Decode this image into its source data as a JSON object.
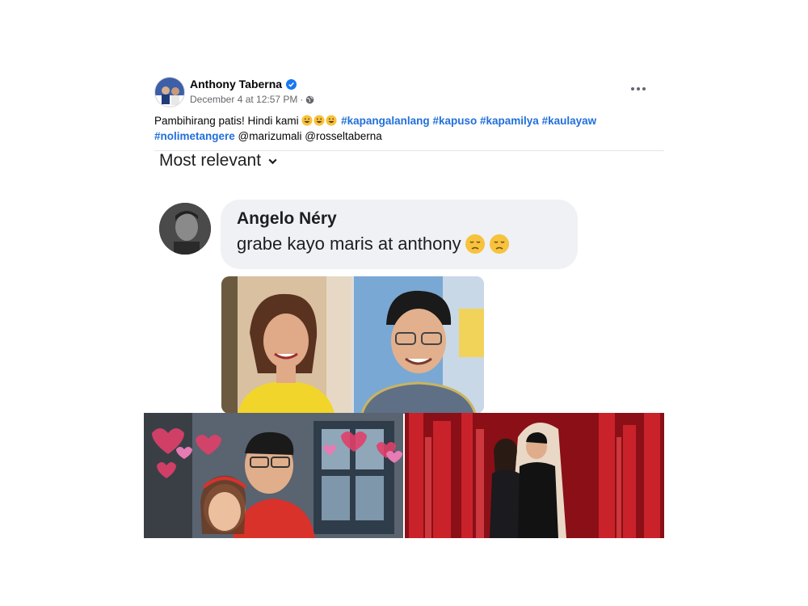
{
  "post": {
    "author": "Anthony Taberna",
    "verified": true,
    "timestamp": "December 4 at 12:57 PM",
    "separator": "·",
    "audience_icon": "globe-icon",
    "caption_text": "Pambihirang patis! Hindi kami",
    "emoji_count": 3,
    "hashtags_line1": [
      "#kapangalanlang",
      "#kapuso",
      "#kapamilya",
      "#kaulayaw"
    ],
    "hashtags_line2": [
      "#nolimetangere"
    ],
    "mentions": [
      "@marizumali",
      "@rosseltaberna"
    ]
  },
  "comment_screenshot": {
    "sort_label": "Most relevant",
    "commenter_name": "Angelo Néry",
    "comment_text": "grabe kayo maris at anthony"
  },
  "colors": {
    "hashtag": "#216fdb",
    "meta": "#65676b",
    "verified_badge": "#1877f2",
    "bubble": "#eff1f4"
  }
}
